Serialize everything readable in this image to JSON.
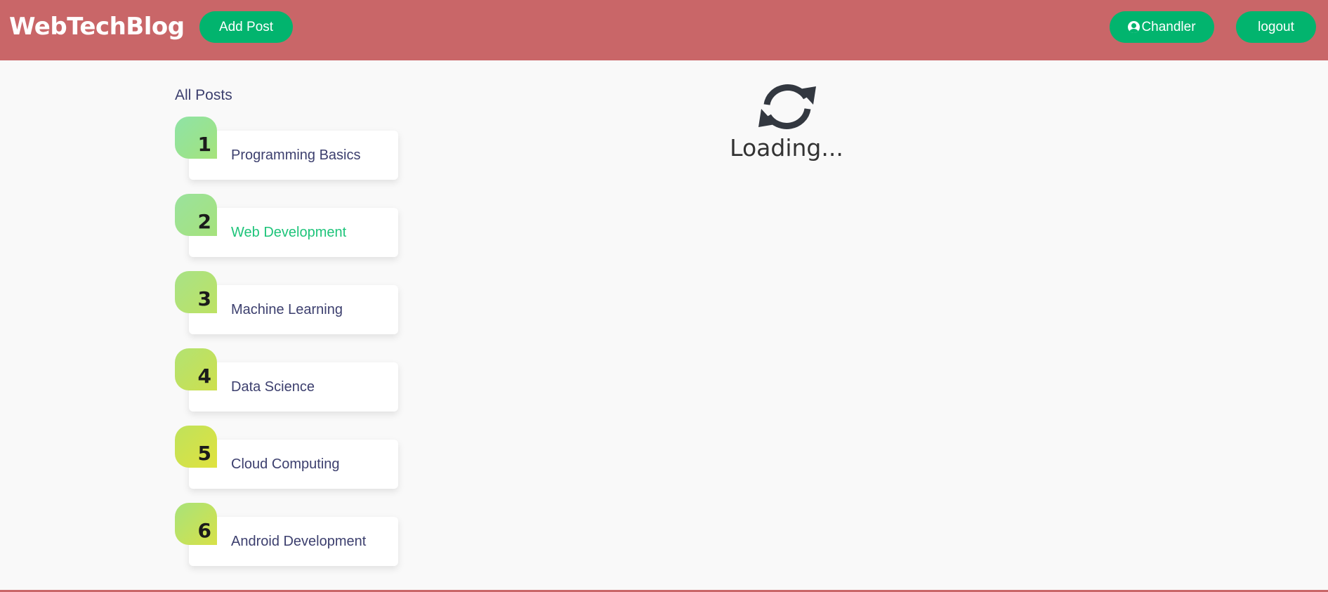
{
  "header": {
    "brand": "WebTechBlog",
    "add_post_label": "Add Post",
    "user_label": "Chandler",
    "user_icon": "user-circle-icon",
    "logout_label": "logout",
    "background_color": "#c96668",
    "button_color": "#02b46e"
  },
  "sidebar": {
    "title": "All Posts",
    "posts": [
      {
        "number": "1",
        "title": "Programming Basics",
        "active": false
      },
      {
        "number": "2",
        "title": "Web Development",
        "active": true
      },
      {
        "number": "3",
        "title": "Machine Learning",
        "active": false
      },
      {
        "number": "4",
        "title": "Data Science",
        "active": false
      },
      {
        "number": "5",
        "title": "Cloud Computing",
        "active": false
      },
      {
        "number": "6",
        "title": "Android Development",
        "active": false
      }
    ],
    "active_color": "#1ec47a"
  },
  "main": {
    "loading_icon": "reload-icon",
    "loading_text": "Loading..."
  }
}
